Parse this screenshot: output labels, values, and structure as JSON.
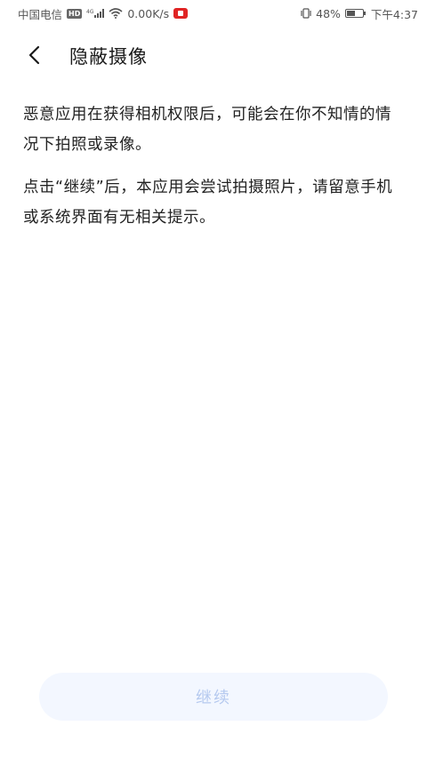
{
  "status_bar": {
    "carrier": "中国电信",
    "hd_badge": "HD",
    "network_type": "4G",
    "speed": "0.00K/s",
    "battery_percent": "48%",
    "time": "下午4:37"
  },
  "header": {
    "title": "隐蔽摄像"
  },
  "content": {
    "paragraph_1": "恶意应用在获得相机权限后，可能会在你不知情的情况下拍照或录像。",
    "paragraph_2": "点击“继续”后，本应用会尝试拍摄照片，请留意手机或系统界面有无相关提示。"
  },
  "footer": {
    "continue_label": "继续",
    "continue_state": "disabled"
  },
  "colors": {
    "button_bg": "#f3f7ff",
    "button_text": "#b5c9ef",
    "recording_indicator": "#e02424"
  }
}
